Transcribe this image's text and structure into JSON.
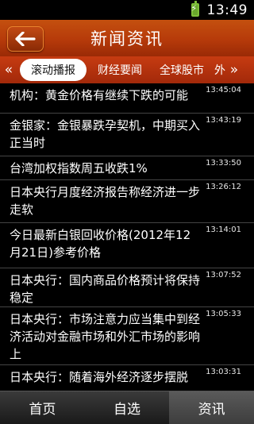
{
  "status": {
    "time": "13:49"
  },
  "header": {
    "title": "新闻资讯",
    "back_icon": "arrow-left-icon"
  },
  "tabs": {
    "left_arrow": "«",
    "right_arrow": "»",
    "items": [
      "滚动播报",
      "财经要闻",
      "全球股市",
      "外"
    ]
  },
  "news": [
    {
      "title": "机构：黄金价格有继续下跌的可能",
      "time": "13:45:04"
    },
    {
      "title": "金银家：金银暴跌孕契机，中期买入正当时",
      "time": "13:43:19"
    },
    {
      "title": "台湾加权指数周五收跌1%",
      "time": "13:33:50"
    },
    {
      "title": "日本央行月度经济报告称经济进一步走软",
      "time": "13:26:12"
    },
    {
      "title": "今日最新白银回收价格(2012年12月21日)参考价格",
      "time": "13:14:01"
    },
    {
      "title": "日本央行：国内商品价格预计将保持稳定",
      "time": "13:07:52"
    },
    {
      "title": "日本央行：市场注意力应当集中到经济活动对金融市场和外汇市场的影响上",
      "time": "13:05:33"
    },
    {
      "title": "日本央行：随着海外经济逐步摆脱",
      "time": "13:03:31"
    }
  ],
  "bottom_nav": [
    "首页",
    "自选",
    "资讯"
  ],
  "colors": {
    "header": "#b63a0a",
    "tabbar": "#c63b11",
    "background": "#000000"
  }
}
